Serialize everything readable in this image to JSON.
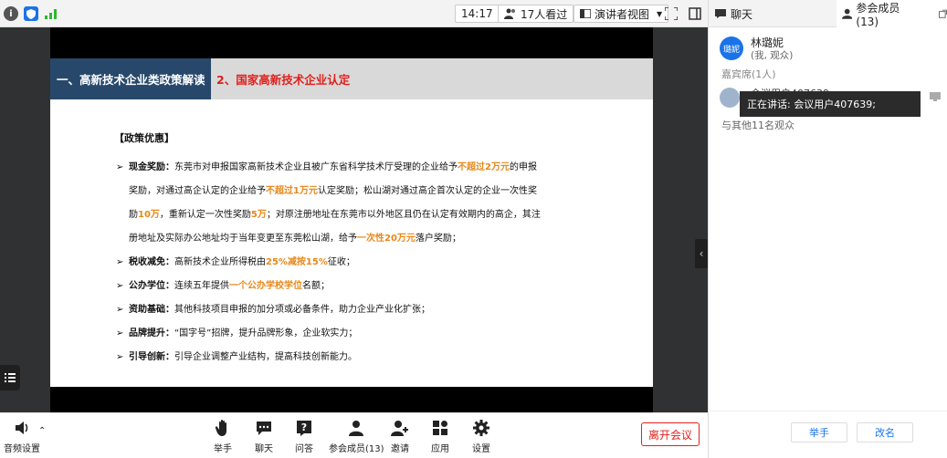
{
  "topbar": {
    "time": "14:17",
    "viewers": "17人看过",
    "view_mode": "演讲者视图"
  },
  "slide": {
    "tab_left": "一、高新技术企业类政策解读",
    "tab_right": "2、国家高新技术企业认定",
    "section_title": "【政策优惠】",
    "items": [
      {
        "label": "现金奖励：",
        "lines": [
          [
            "东莞市对申报国家高新技术企业且被广东省科学技术厅受理的企业给予",
            "不超过2万元",
            "的申报"
          ],
          [
            "奖励，对通过高企认定的企业给予",
            "不超过1万元",
            "认定奖励；松山湖对通过高企首次认定的企业一次性奖"
          ],
          [
            "励",
            "10万",
            "，重新认定一次性奖励",
            "5万",
            "；对原注册地址在东莞市以外地区且仍在认定有效期内的高企，其注"
          ],
          [
            "册地址及实际办公地址均于当年变更至东莞松山湖，给予",
            "一次性20万元",
            "落户奖励；"
          ]
        ]
      },
      {
        "label": "税收减免：",
        "text_a": "高新技术企业所得税由",
        "hl": "25%减按15%",
        "text_b": "征收；"
      },
      {
        "label": "公办学位：",
        "text_a": "连续五年提供",
        "hl": "一个公办学校学位",
        "text_b": "名额；"
      },
      {
        "label": "资助基础：",
        "text_a": "其他科技项目申报的加分项或必备条件，助力企业产业化扩张；",
        "hl": "",
        "text_b": ""
      },
      {
        "label": "品牌提升：",
        "text_a": "“国字号”招牌，提升品牌形象，企业软实力；",
        "hl": "",
        "text_b": ""
      },
      {
        "label": "引导创新：",
        "text_a": "引导企业调整产业结构，提高科技创新能力。",
        "hl": "",
        "text_b": ""
      }
    ]
  },
  "toolbar": {
    "audio_settings": "音频设置",
    "raise_hand": "举手",
    "chat": "聊天",
    "qa": "问答",
    "participants": "参会成员(13)",
    "invite": "邀请",
    "apps": "应用",
    "settings": "设置",
    "leave": "离开会议"
  },
  "panel": {
    "tab_chat": "聊天",
    "tab_members": "参会成员(13)",
    "host_avatar": "璐妮",
    "host_name": "林璐妮",
    "host_role": "(我, 观众)",
    "guest_header": "嘉宾席(1人)",
    "guest_name": "会议用户407639",
    "speaking_tip": "正在讲话: 会议用户407639;",
    "audience": "与其他11名观众",
    "raise_hand_btn": "举手",
    "rename_btn": "改名"
  },
  "colors": {
    "accent": "#1a73e8",
    "slide_navy": "#27486b",
    "title_red": "#e0201c",
    "highlight_orange": "#e8881a"
  }
}
